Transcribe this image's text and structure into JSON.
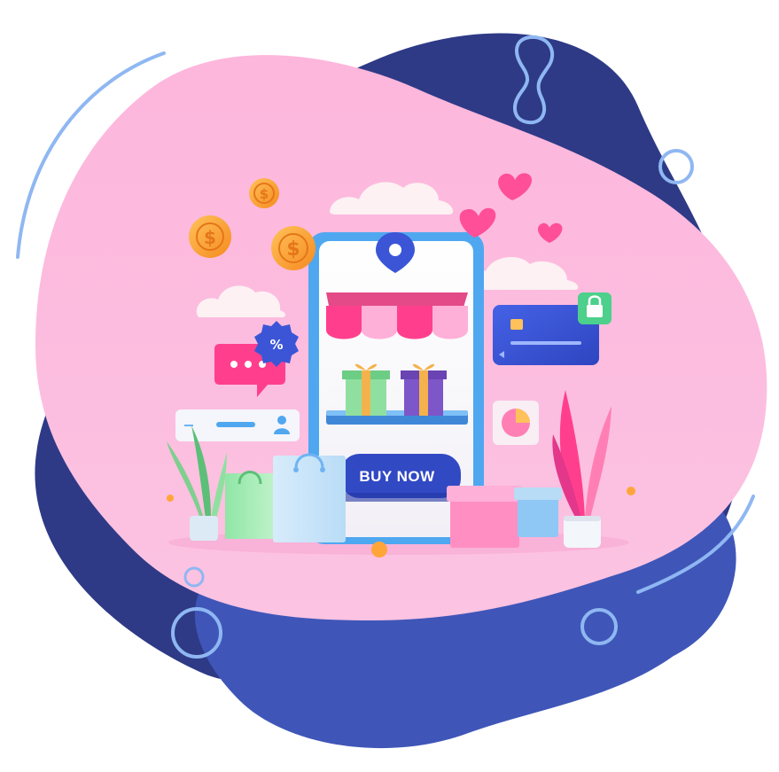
{
  "buy_button": {
    "label": "BUY NOW"
  },
  "discount_badge": {
    "symbol": "%"
  },
  "coins": {
    "symbol": "$"
  },
  "colors": {
    "blob_navy": "#2e3a86",
    "blob_blue": "#3f56b8",
    "blob_pink": "#fdb9df",
    "phone_frame": "#4fa7f0",
    "accent_magenta": "#ff3f8e",
    "button_blue": "#3249c4",
    "card_blue": "#3b55d6",
    "lock_green": "#4cd08b",
    "coin_orange": "#ffa53a",
    "outline_light_blue": "#8fb7f2"
  },
  "icons": [
    "location-pin-icon",
    "store-awning-icon",
    "gift-box-icon",
    "credit-card-icon",
    "lock-icon",
    "chat-bubble-icon",
    "discount-badge-icon",
    "search-bar-icon",
    "user-icon",
    "pie-chart-icon",
    "heart-icon",
    "coin-icon",
    "shopping-bag-icon",
    "cloud-icon",
    "plant-icon"
  ]
}
